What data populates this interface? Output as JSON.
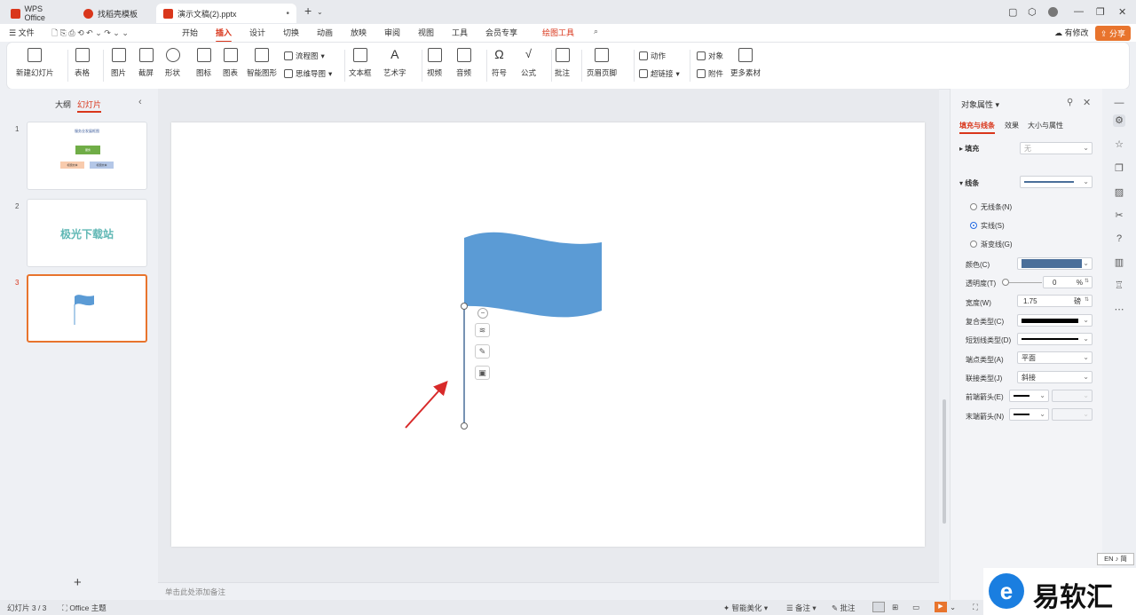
{
  "tabs": [
    {
      "label": "WPS Office",
      "icon": "wps-logo-icon",
      "color": "#d9361b"
    },
    {
      "label": "找稻壳模板",
      "icon": "docer-icon",
      "color": "#d9361b"
    },
    {
      "label": "演示文稿(2).pptx",
      "icon": "ppt-icon",
      "color": "#d9361b"
    }
  ],
  "menu": {
    "file": "文件",
    "items": [
      "开始",
      "插入",
      "设计",
      "切换",
      "动画",
      "放映",
      "审阅",
      "视图",
      "工具",
      "会员专享",
      "绘图工具"
    ],
    "active": "插入",
    "modify": "有修改",
    "share": "分享"
  },
  "ribbon": {
    "new_slide": "新建幻灯片",
    "table": "表格",
    "picture": "图片",
    "screenshot": "截屏",
    "shape": "形状",
    "icon": "图标",
    "chart": "图表",
    "smart_shape": "智能图形",
    "flowchart": "流程图",
    "mindmap": "思维导图",
    "textbox": "文本框",
    "wordart": "艺术字",
    "video": "视频",
    "audio": "音频",
    "symbol": "符号",
    "formula": "公式",
    "comment": "批注",
    "header_footer": "页眉页脚",
    "action": "动作",
    "hyperlink": "超链接",
    "object": "对象",
    "attachment": "附件",
    "more": "更多素材"
  },
  "left_panel": {
    "tab_outline": "大纲",
    "tab_slides": "幻灯片",
    "slides": [
      {
        "num": "1",
        "title": "服务业发展框图",
        "center": "服务",
        "left": "标题文本",
        "right": "标题文本"
      },
      {
        "num": "2",
        "text": "极光下载站"
      },
      {
        "num": "3"
      }
    ]
  },
  "notes_placeholder": "单击此处添加备注",
  "properties": {
    "title": "对象属性",
    "tabs": [
      "填充与线条",
      "效果",
      "大小与属性"
    ],
    "fill_label": "填充",
    "fill_value": "无",
    "line_label": "线条",
    "radio_none": "无线条(N)",
    "radio_solid": "实线(S)",
    "radio_gradient": "渐变线(G)",
    "color_label": "颜色(C)",
    "line_color": "#4a6f9a",
    "transparency_label": "透明度(T)",
    "transparency_value": "0",
    "transparency_unit": "%",
    "width_label": "宽度(W)",
    "width_value": "1.75",
    "width_unit": "磅",
    "compound_label": "复合类型(C)",
    "dash_label": "短划线类型(D)",
    "cap_label": "端点类型(A)",
    "cap_value": "平面",
    "join_label": "联接类型(J)",
    "join_value": "斜接",
    "begin_arrow_label": "前端箭头(E)",
    "end_arrow_label": "末端箭头(N)"
  },
  "status": {
    "slide_count": "幻灯片 3 / 3",
    "theme": "Office 主题",
    "beautify": "智能美化",
    "notes": "备注",
    "comments": "批注"
  },
  "ime": "EN ♪ 简",
  "watermark": "易软汇",
  "colors": {
    "accent": "#d9361b",
    "flag": "#5b9bd5",
    "selected_thumb": "#e8742d"
  }
}
